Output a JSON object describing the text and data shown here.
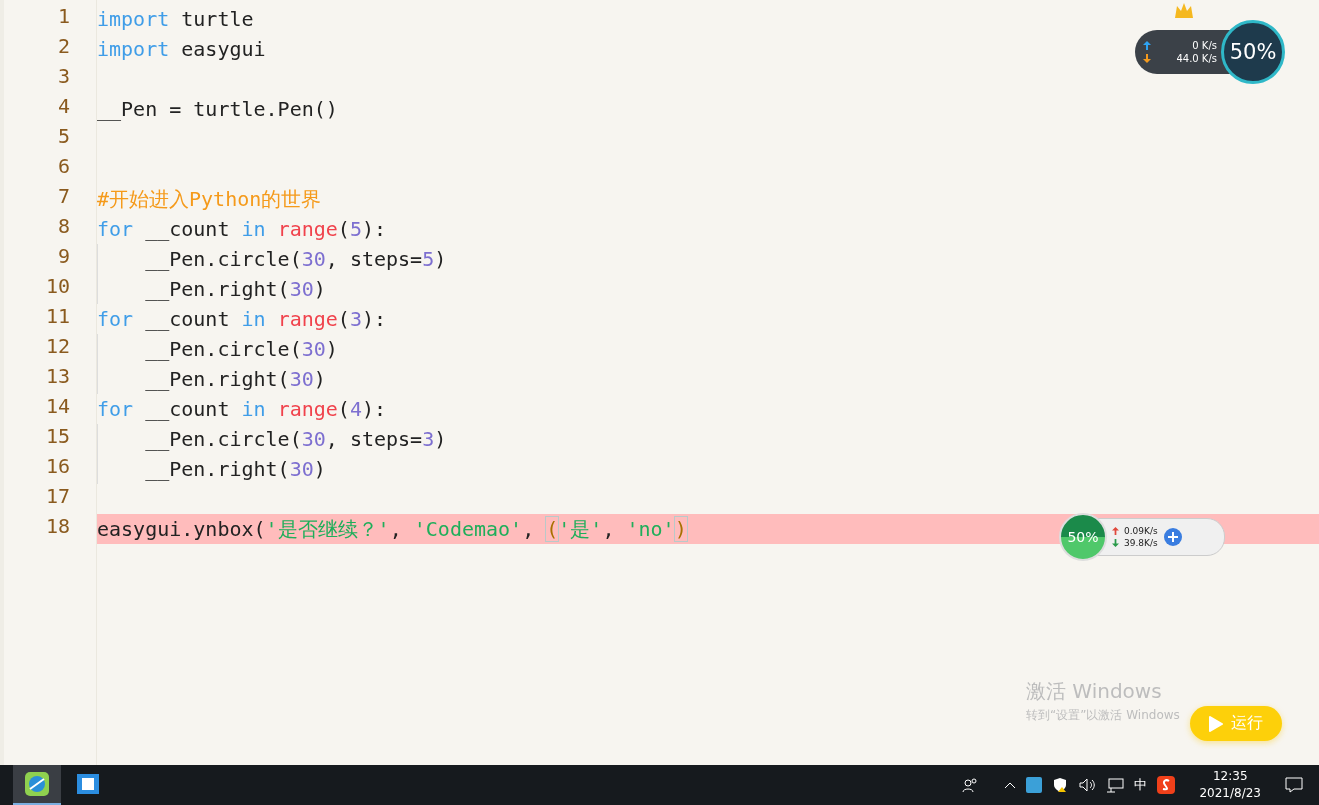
{
  "editor": {
    "lines": [
      {
        "number": "1",
        "guide": false,
        "highlighted": false,
        "tokens": [
          {
            "kind": "keyword",
            "text": "import"
          },
          {
            "kind": "plain",
            "text": " turtle"
          }
        ]
      },
      {
        "number": "2",
        "guide": false,
        "highlighted": false,
        "tokens": [
          {
            "kind": "keyword",
            "text": "import"
          },
          {
            "kind": "plain",
            "text": " easygui"
          }
        ]
      },
      {
        "number": "3",
        "guide": false,
        "highlighted": false
      },
      {
        "number": "4",
        "guide": false,
        "highlighted": false,
        "tokens": [
          {
            "kind": "plain",
            "text": "__Pen = turtle.Pen()"
          }
        ]
      },
      {
        "number": "5",
        "guide": false,
        "highlighted": false
      },
      {
        "number": "6",
        "guide": false,
        "highlighted": false
      },
      {
        "number": "7",
        "guide": false,
        "highlighted": false,
        "tokens": [
          {
            "kind": "comment",
            "text": "#开始进入Python的世界"
          }
        ]
      },
      {
        "number": "8",
        "guide": false,
        "highlighted": false,
        "tokens": [
          {
            "kind": "keyword",
            "text": "for"
          },
          {
            "kind": "plain",
            "text": " __count "
          },
          {
            "kind": "keyword",
            "text": "in"
          },
          {
            "kind": "builtin",
            "text": " range"
          },
          {
            "kind": "plain",
            "text": "("
          },
          {
            "kind": "number",
            "text": "5"
          },
          {
            "kind": "plain",
            "text": "):"
          }
        ]
      },
      {
        "number": "9",
        "guide": true,
        "highlighted": false,
        "tokens": [
          {
            "kind": "plain",
            "text": "    __Pen.circle("
          },
          {
            "kind": "number",
            "text": "30"
          },
          {
            "kind": "plain",
            "text": ", steps="
          },
          {
            "kind": "number",
            "text": "5"
          },
          {
            "kind": "plain",
            "text": ")"
          }
        ]
      },
      {
        "number": "10",
        "guide": true,
        "highlighted": false,
        "tokens": [
          {
            "kind": "plain",
            "text": "    __Pen.right("
          },
          {
            "kind": "number",
            "text": "30"
          },
          {
            "kind": "plain",
            "text": ")"
          }
        ]
      },
      {
        "number": "11",
        "guide": false,
        "highlighted": false,
        "tokens": [
          {
            "kind": "keyword",
            "text": "for"
          },
          {
            "kind": "plain",
            "text": " __count "
          },
          {
            "kind": "keyword",
            "text": "in"
          },
          {
            "kind": "builtin",
            "text": " range"
          },
          {
            "kind": "plain",
            "text": "("
          },
          {
            "kind": "number",
            "text": "3"
          },
          {
            "kind": "plain",
            "text": "):"
          }
        ]
      },
      {
        "number": "12",
        "guide": true,
        "highlighted": false,
        "tokens": [
          {
            "kind": "plain",
            "text": "    __Pen.circle("
          },
          {
            "kind": "number",
            "text": "30"
          },
          {
            "kind": "plain",
            "text": ")"
          }
        ]
      },
      {
        "number": "13",
        "guide": true,
        "highlighted": false,
        "tokens": [
          {
            "kind": "plain",
            "text": "    __Pen.right("
          },
          {
            "kind": "number",
            "text": "30"
          },
          {
            "kind": "plain",
            "text": ")"
          }
        ]
      },
      {
        "number": "14",
        "guide": false,
        "highlighted": false,
        "tokens": [
          {
            "kind": "keyword",
            "text": "for"
          },
          {
            "kind": "plain",
            "text": " __count "
          },
          {
            "kind": "keyword",
            "text": "in"
          },
          {
            "kind": "builtin",
            "text": " range"
          },
          {
            "kind": "plain",
            "text": "("
          },
          {
            "kind": "number",
            "text": "4"
          },
          {
            "kind": "plain",
            "text": "):"
          }
        ]
      },
      {
        "number": "15",
        "guide": true,
        "highlighted": false,
        "tokens": [
          {
            "kind": "plain",
            "text": "    __Pen.circle("
          },
          {
            "kind": "number",
            "text": "30"
          },
          {
            "kind": "plain",
            "text": ", steps="
          },
          {
            "kind": "number",
            "text": "3"
          },
          {
            "kind": "plain",
            "text": ")"
          }
        ]
      },
      {
        "number": "16",
        "guide": true,
        "highlighted": false,
        "tokens": [
          {
            "kind": "plain",
            "text": "    __Pen.right("
          },
          {
            "kind": "number",
            "text": "30"
          },
          {
            "kind": "plain",
            "text": ")"
          }
        ]
      },
      {
        "number": "17",
        "guide": false,
        "highlighted": false
      },
      {
        "number": "18",
        "guide": false,
        "highlighted": true,
        "tokens": [
          {
            "kind": "plain",
            "text": "easygui.ynbox("
          },
          {
            "kind": "string",
            "text": "'是否继续？'"
          },
          {
            "kind": "plain",
            "text": ", "
          },
          {
            "kind": "string",
            "text": "'Codemao'"
          },
          {
            "kind": "plain",
            "text": ", "
          },
          {
            "kind": "bracket",
            "text": "("
          },
          {
            "kind": "string",
            "text": "'是'"
          },
          {
            "kind": "plain",
            "text": ", "
          },
          {
            "kind": "string",
            "text": "'no'"
          },
          {
            "kind": "bracket",
            "text": ")"
          }
        ]
      }
    ]
  },
  "speed_widget": {
    "upload": "0 K/s",
    "download": "44.0 K/s",
    "gauge": "50%"
  },
  "ball_widget": {
    "gauge": "50%",
    "upload": "0.09K/s",
    "download": "39.8K/s"
  },
  "activation_notice": {
    "title": "激活 Windows",
    "subtitle": "转到“设置”以激活 Windows"
  },
  "run_button": {
    "label": "运行"
  },
  "taskbar": {
    "apps": [
      {
        "selected": true
      },
      {
        "selected": false
      }
    ],
    "ime": "中",
    "time": "12:35",
    "date": "2021/8/23"
  }
}
